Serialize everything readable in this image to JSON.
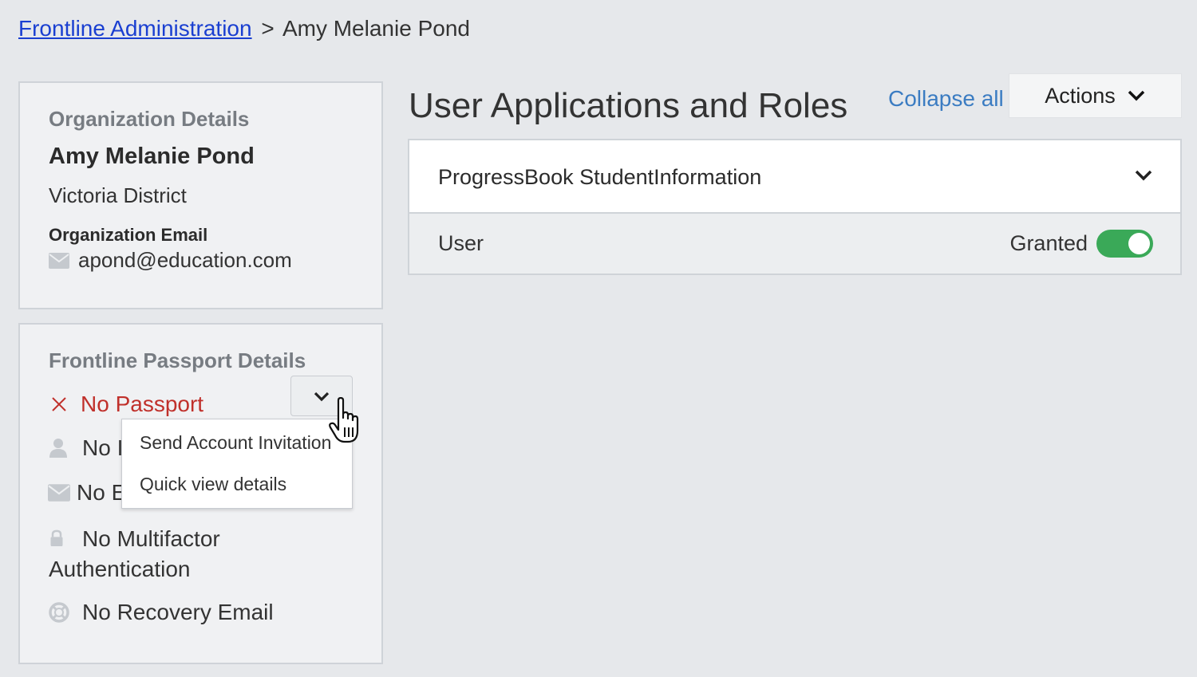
{
  "breadcrumb": {
    "root": "Frontline Administration",
    "separator": ">",
    "current": "Amy Melanie Pond"
  },
  "organization": {
    "heading": "Organization Details",
    "name": "Amy Melanie Pond",
    "district": "Victoria District",
    "email_label": "Organization Email",
    "email": "apond@education.com"
  },
  "passport": {
    "heading": "Frontline Passport Details",
    "status": "No Passport",
    "row_username_partial": "No I",
    "row_email_partial": "No E",
    "mfa": "No Multifactor Authentication",
    "recovery": "No Recovery Email",
    "dropdown": {
      "items": [
        "Send Account Invitation",
        "Quick view details"
      ]
    }
  },
  "applications": {
    "title": "User Applications and Roles",
    "collapse_all": "Collapse all",
    "actions_label": "Actions",
    "list": [
      {
        "name": "ProgressBook StudentInformation",
        "roles": [
          {
            "name": "User",
            "status": "Granted",
            "enabled": true
          }
        ]
      }
    ]
  },
  "colors": {
    "link": "#1a3fd1",
    "accent_link": "#3b7cc2",
    "error": "#c0302b",
    "toggle_on": "#3aa958"
  },
  "icons": [
    "envelope-icon",
    "close-x-icon",
    "user-icon",
    "lock-icon",
    "lifebuoy-icon",
    "chevron-down-icon",
    "hand-pointer-cursor-icon"
  ]
}
